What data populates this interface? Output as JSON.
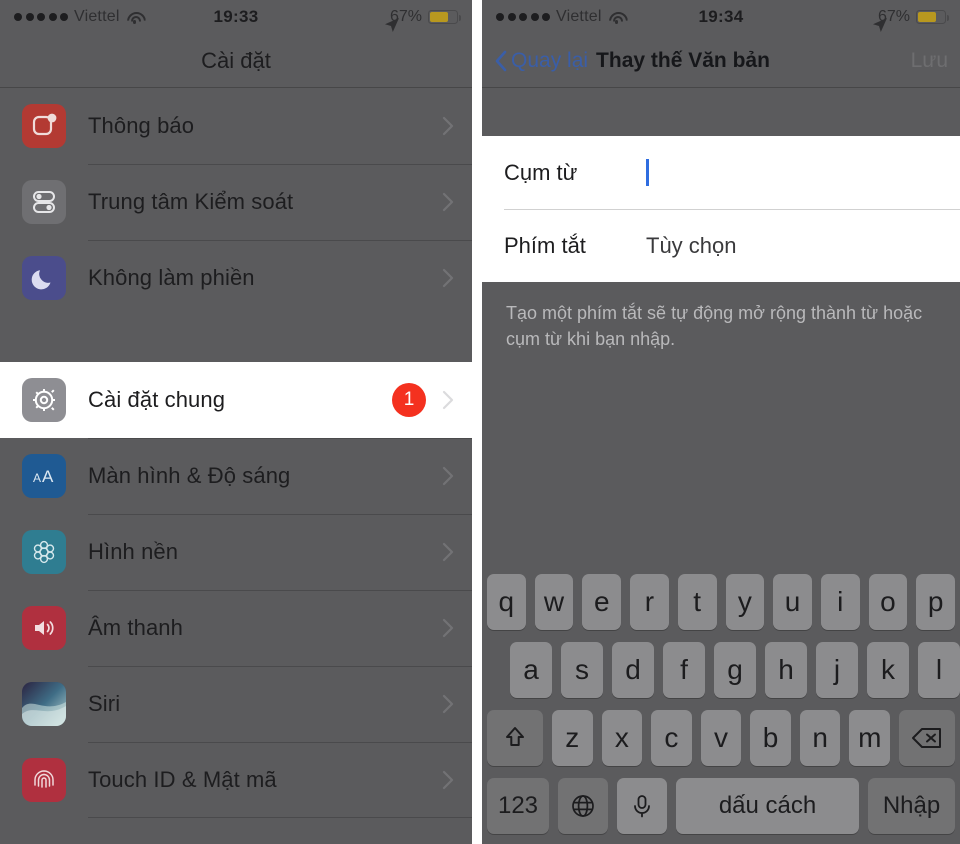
{
  "colors": {
    "dim_overlay": "#5b5b5d",
    "badge_red": "#f4311f",
    "link_blue": "#3a5ea8",
    "caret_blue": "#2f6de0",
    "battery_fill": "#b8981f",
    "page_background": "#ffffff"
  },
  "left_panel": {
    "status_bar": {
      "signal_dots": 5,
      "carrier": "Viettel",
      "wifi_icon": "wifi-icon",
      "time": "19:33",
      "location_icon": "location-arrow-icon",
      "battery_percent": "67%",
      "battery_icon": "battery-icon"
    },
    "nav": {
      "title": "Cài đặt"
    },
    "groups": [
      {
        "rows": [
          {
            "label": "Thông báo",
            "icon": "notifications-icon",
            "icon_bg": "#b33a33",
            "chevron": "chevron-right-icon",
            "badge": null,
            "highlighted": false
          },
          {
            "label": "Trung tâm Kiểm soát",
            "icon": "control-center-icon",
            "icon_bg": "#6f6f72",
            "chevron": "chevron-right-icon",
            "badge": null,
            "highlighted": false
          },
          {
            "label": "Không làm phiền",
            "icon": "do-not-disturb-moon-icon",
            "icon_bg": "#4b4d8c",
            "chevron": "chevron-right-icon",
            "badge": null,
            "highlighted": false
          }
        ]
      },
      {
        "rows": [
          {
            "label": "Cài đặt chung",
            "icon": "gear-icon",
            "icon_bg": "#8e8e93",
            "chevron": "chevron-right-icon",
            "badge": "1",
            "highlighted": true
          },
          {
            "label": "Màn hình & Độ sáng",
            "icon": "display-brightness-icon",
            "icon_bg": "#1f5a93",
            "chevron": "chevron-right-icon",
            "badge": null,
            "highlighted": false
          },
          {
            "label": "Hình nền",
            "icon": "wallpaper-icon",
            "icon_bg": "#2f7d91",
            "chevron": "chevron-right-icon",
            "badge": null,
            "highlighted": false
          },
          {
            "label": "Âm thanh",
            "icon": "sound-speaker-icon",
            "icon_bg": "#b0303f",
            "chevron": "chevron-right-icon",
            "badge": null,
            "highlighted": false
          },
          {
            "label": "Siri",
            "icon": "siri-icon",
            "icon_bg": "#3c4a63",
            "chevron": "chevron-right-icon",
            "badge": null,
            "highlighted": false
          },
          {
            "label": "Touch ID & Mật mã",
            "icon": "touch-id-fingerprint-icon",
            "icon_bg": "#b0303f",
            "chevron": "chevron-right-icon",
            "badge": null,
            "highlighted": false
          }
        ]
      }
    ]
  },
  "right_panel": {
    "status_bar": {
      "signal_dots": 5,
      "carrier": "Viettel",
      "wifi_icon": "wifi-icon",
      "time": "19:34",
      "location_icon": "location-arrow-icon",
      "battery_percent": "67%",
      "battery_icon": "battery-icon"
    },
    "nav": {
      "back_icon": "chevron-left-icon",
      "back_label": "Quay lại",
      "title": "Thay thế Văn bản",
      "save_label": "Lưu",
      "save_enabled": false
    },
    "form": {
      "rows": [
        {
          "label": "Cụm từ",
          "value": "",
          "placeholder": "",
          "focused": true
        },
        {
          "label": "Phím tắt",
          "value": "Tùy chọn",
          "placeholder": "Tùy chọn",
          "focused": false
        }
      ]
    },
    "hint": "Tạo một phím tắt sẽ tự động mở rộng thành từ hoặc cụm từ khi bạn nhập.",
    "keyboard": {
      "row1": [
        "q",
        "w",
        "e",
        "r",
        "t",
        "y",
        "u",
        "i",
        "o",
        "p"
      ],
      "row2": [
        "a",
        "s",
        "d",
        "f",
        "g",
        "h",
        "j",
        "k",
        "l"
      ],
      "row3_shift_icon": "shift-arrow-icon",
      "row3": [
        "z",
        "x",
        "c",
        "v",
        "b",
        "n",
        "m"
      ],
      "row3_delete_icon": "backspace-delete-icon",
      "numbers_key": "123",
      "globe_icon": "globe-language-icon",
      "mic_icon": "microphone-icon",
      "space_key": "dấu cách",
      "return_key": "Nhập"
    }
  }
}
